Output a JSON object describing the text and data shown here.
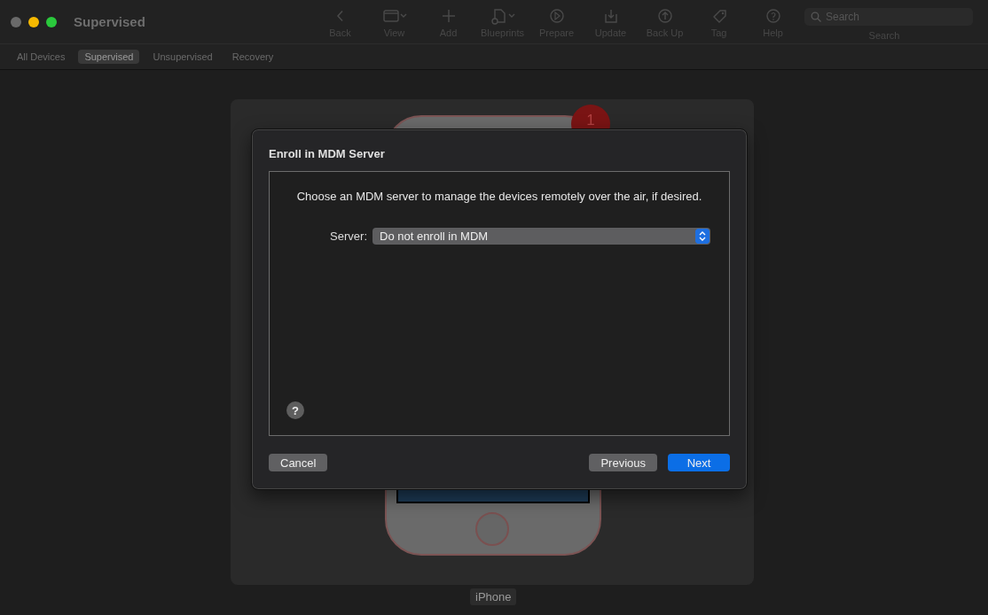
{
  "window": {
    "title": "Supervised"
  },
  "toolbar": [
    {
      "label": "Back",
      "kind": "back"
    },
    {
      "label": "View",
      "kind": "view"
    },
    {
      "label": "Add",
      "kind": "add"
    },
    {
      "label": "Blueprints",
      "kind": "blueprints"
    },
    {
      "label": "Prepare",
      "kind": "prepare"
    },
    {
      "label": "Update",
      "kind": "update"
    },
    {
      "label": "Back Up",
      "kind": "backup"
    },
    {
      "label": "Tag",
      "kind": "tag"
    },
    {
      "label": "Help",
      "kind": "help"
    }
  ],
  "search": {
    "placeholder": "Search",
    "label": "Search"
  },
  "tabs": [
    {
      "label": "All Devices",
      "selected": false
    },
    {
      "label": "Supervised",
      "selected": true
    },
    {
      "label": "Unsupervised",
      "selected": false
    },
    {
      "label": "Recovery",
      "selected": false
    }
  ],
  "device": {
    "name": "iPhone",
    "badge": "1"
  },
  "dialog": {
    "title": "Enroll in MDM Server",
    "message": "Choose an MDM server to manage the devices remotely over the air, if desired.",
    "server": {
      "label": "Server:",
      "value": "Do not enroll in MDM"
    },
    "help_button": "?",
    "buttons": [
      {
        "label": "Cancel",
        "kind": "secondary"
      },
      {
        "label": "Previous",
        "kind": "secondary"
      },
      {
        "label": "Next",
        "kind": "primary"
      }
    ]
  }
}
